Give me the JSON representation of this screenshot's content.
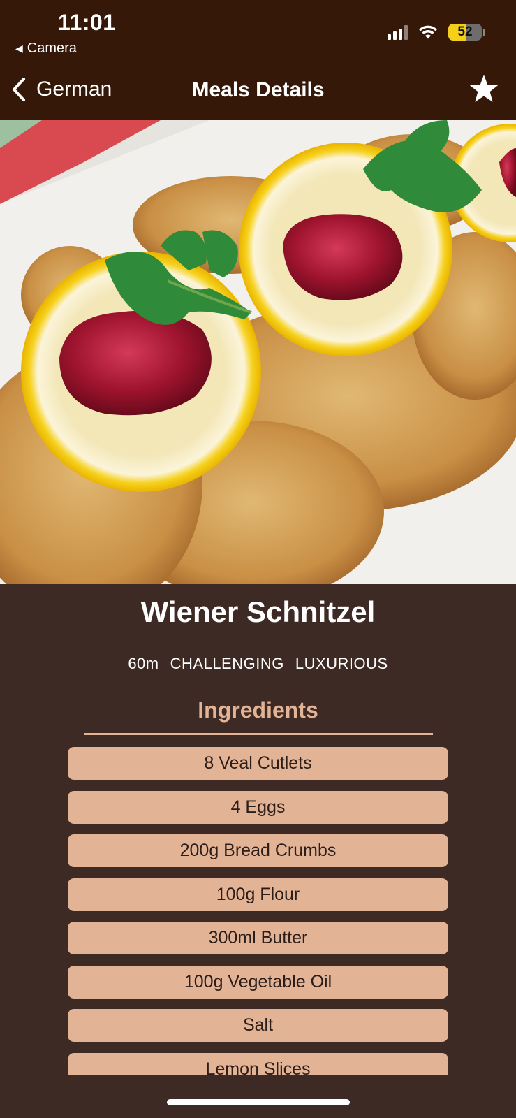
{
  "status_bar": {
    "time": "11:01",
    "back_app": "Camera",
    "battery_level": "52",
    "battery_fraction": 0.52
  },
  "nav": {
    "back_label": "German",
    "title": "Meals Details",
    "favorite_icon": "star-icon"
  },
  "meal": {
    "title": "Wiener Schnitzel",
    "duration": "60m",
    "complexity": "CHALLENGING",
    "affordability": "LUXURIOUS"
  },
  "ingredients": {
    "heading": "Ingredients",
    "items": [
      "8 Veal Cutlets",
      "4 Eggs",
      "200g Bread Crumbs",
      "100g Flour",
      "300ml Butter",
      "100g Vegetable Oil",
      "Salt",
      "Lemon Slices"
    ]
  },
  "colors": {
    "header_bg": "#351808",
    "page_bg": "#3e2a24",
    "accent": "#e3b396",
    "ingredient_text": "#2c1d18"
  }
}
